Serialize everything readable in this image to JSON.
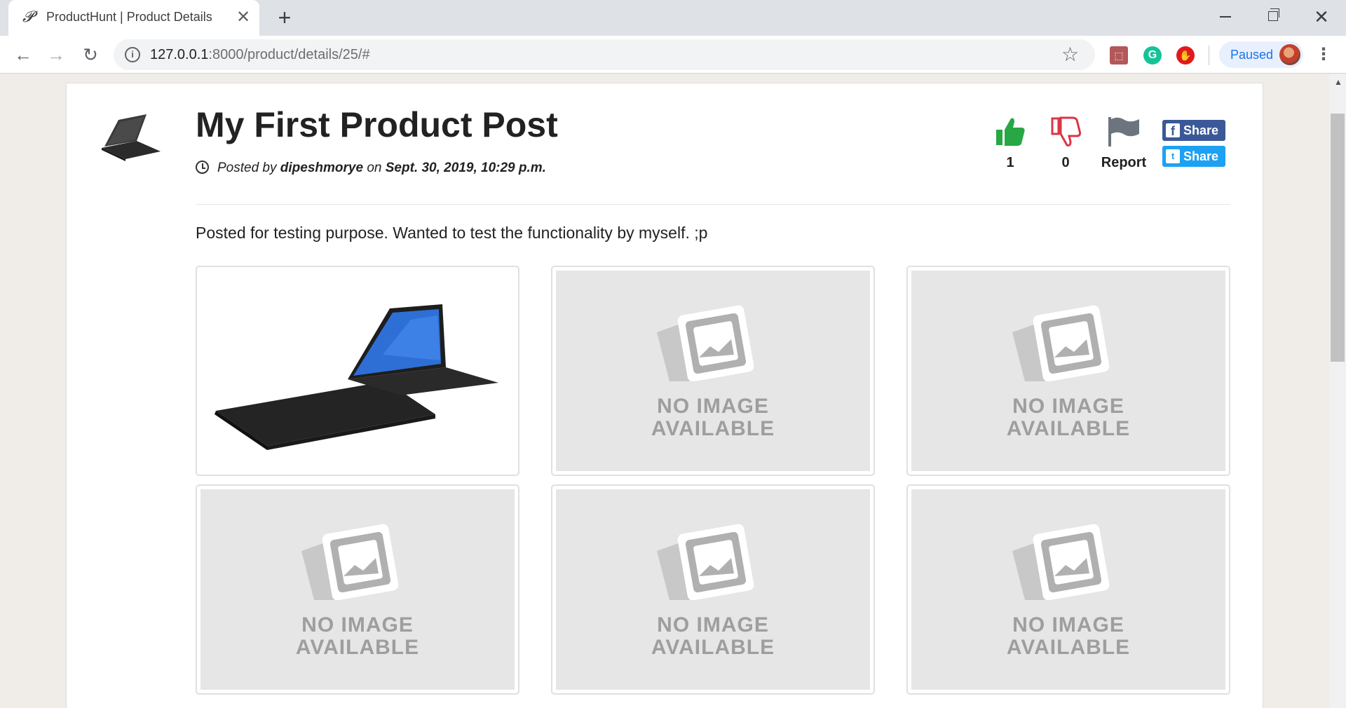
{
  "browser": {
    "tab_title": "ProductHunt | Product Details",
    "tab_favicon": "𝓟",
    "url_host": "127.0.0.1",
    "url_path": ":8000/product/details/25/#",
    "profile_status": "Paused",
    "icons": {
      "back": "←",
      "forward": "→",
      "reload": "↻",
      "star": "☆",
      "close": "✕",
      "new_tab": "+",
      "menu": "⋮",
      "info": "i"
    },
    "extensions": [
      "pdf-extension-icon",
      "grammarly-icon",
      "adblock-icon"
    ]
  },
  "product": {
    "title": "My First Product Post",
    "posted_by_prefix": "Posted by",
    "author": "dipeshmorye",
    "on_word": "on",
    "date": "Sept. 30, 2019, 10:29 p.m.",
    "description": "Posted for testing purpose. Wanted to test the functionality by myself. ;p"
  },
  "actions": {
    "upvotes": "1",
    "downvotes": "0",
    "report_label": "Report",
    "facebook_share": "Share",
    "twitter_share": "Share",
    "facebook_badge": "f",
    "twitter_badge": "t"
  },
  "gallery": {
    "placeholder_line1": "NO IMAGE",
    "placeholder_line2": "AVAILABLE",
    "images": [
      "laptop-photo",
      "no-image",
      "no-image",
      "no-image",
      "no-image",
      "no-image"
    ]
  },
  "colors": {
    "upvote": "#28a745",
    "downvote": "#dc3545",
    "report": "#6c757d",
    "facebook": "#3b5998",
    "twitter": "#1da1f2"
  }
}
